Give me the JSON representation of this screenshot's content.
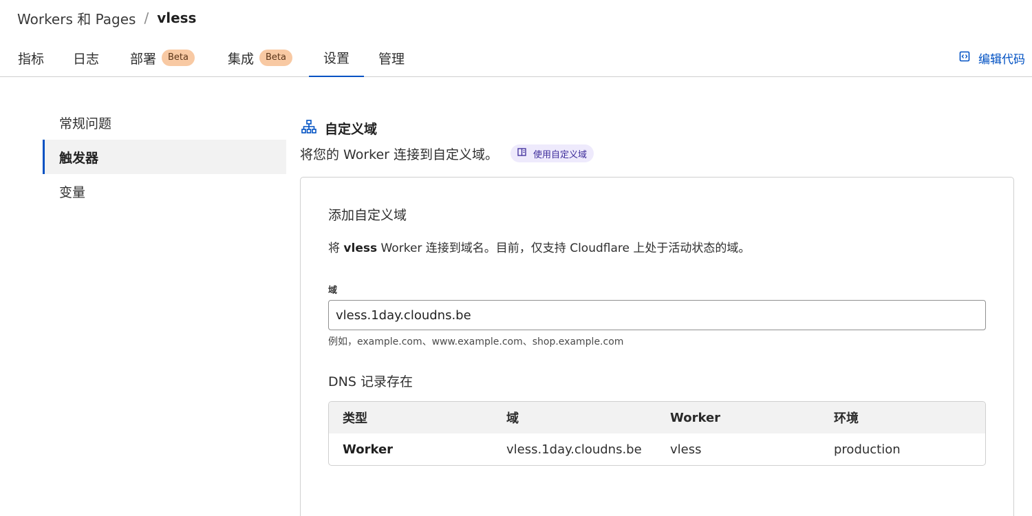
{
  "breadcrumb": {
    "parent": "Workers 和 Pages",
    "separator": "/",
    "current": "vless"
  },
  "tabs": [
    {
      "label": "指标"
    },
    {
      "label": "日志"
    },
    {
      "label": "部署",
      "badge": "Beta"
    },
    {
      "label": "集成",
      "badge": "Beta"
    },
    {
      "label": "设置",
      "active": true
    },
    {
      "label": "管理"
    }
  ],
  "edit_code": {
    "label": "编辑代码",
    "icon": "code-icon"
  },
  "sidebar": {
    "items": [
      {
        "label": "常规问题"
      },
      {
        "label": "触发器",
        "active": true
      },
      {
        "label": "变量"
      }
    ]
  },
  "section": {
    "icon": "sitemap-icon",
    "title": "自定义域",
    "description": "将您的 Worker 连接到自定义域。",
    "doc_link": {
      "label": "使用自定义域",
      "icon": "book-icon"
    }
  },
  "card": {
    "title": "添加自定义域",
    "desc_prefix": "将 ",
    "desc_bold": "vless",
    "desc_suffix": " Worker 连接到域名。目前，仅支持 Cloudflare 上处于活动状态的域。",
    "field_label": "域",
    "field_value": "vless.1day.cloudns.be",
    "field_hint": "例如，example.com、www.example.com、shop.example.com",
    "dns_title": "DNS 记录存在",
    "table": {
      "headers": [
        "类型",
        "域",
        "Worker",
        "环境"
      ],
      "rows": [
        [
          "Worker",
          "vless.1day.cloudns.be",
          "vless",
          "production"
        ]
      ]
    }
  },
  "colors": {
    "accent": "#0051c3",
    "beta_badge": "#f8c9a3",
    "doc_pill": "#eeeafc"
  }
}
